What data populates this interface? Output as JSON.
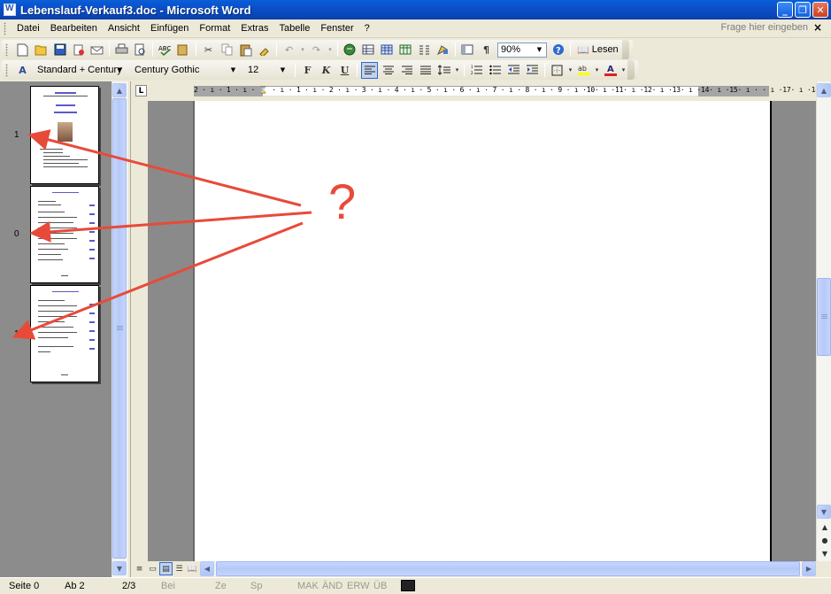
{
  "window": {
    "title": "Lebenslauf-Verkauf3.doc - Microsoft Word",
    "minimize": "_",
    "restore": "❐",
    "close": "✕"
  },
  "menu": {
    "items": [
      "Datei",
      "Bearbeiten",
      "Ansicht",
      "Einfügen",
      "Format",
      "Extras",
      "Tabelle",
      "Fenster",
      "?"
    ],
    "help_placeholder": "Frage hier eingeben",
    "close_doc": "×"
  },
  "standard_toolbar": {
    "zoom": "90%",
    "read_label": "Lesen"
  },
  "format_toolbar": {
    "style": "Standard + Century",
    "font": "Century Gothic",
    "size": "12",
    "bold": "F",
    "italic": "K",
    "underline": "U"
  },
  "thumbnails": {
    "page_numbers": [
      "1",
      "0",
      "1"
    ]
  },
  "ruler": {
    "tab_selector": "L",
    "marks": "2 · ı · 1 · ı · ⌛ · ı · 1 · ı · 2 · ı · 3 · ı · 4 · ı · 5 · ı · 6 · ı · 7 · ı · 8 · ı · 9 · ı ·10· ı ·11· ı ·12· ı ·13· ı ·14· ı ·15· ı ·  · ı ·17· ı ·18·"
  },
  "annotation": {
    "mark": "?",
    "color": "#e84a3a"
  },
  "statusbar": {
    "page": "Seite 0",
    "section": "Ab  2",
    "page_of": "2/3",
    "at": "Bei",
    "line": "Ze",
    "col": "Sp",
    "rec": "MAK",
    "trk": "ÄND",
    "ext": "ERW",
    "ovr": "ÜB"
  }
}
